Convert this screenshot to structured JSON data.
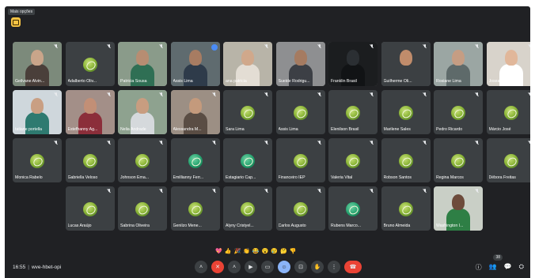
{
  "topbar": {
    "tooltip": "Mais opções"
  },
  "rows": [
    [
      {
        "name": "Geilvane Alvin...",
        "type": "video",
        "bg": "#7c8a7b",
        "skin": "#c9a58a",
        "shirt": "#4a3f3a"
      },
      {
        "name": "Adalberto Oliv...",
        "type": "avatar"
      },
      {
        "name": "Patricia Sousa",
        "type": "video",
        "bg": "#8a9b8a",
        "skin": "#b78d72",
        "shirt": "#2f6f54"
      },
      {
        "name": "Assis Lima",
        "type": "video",
        "bg": "#5f6b6f",
        "skin": "#a77c62",
        "shirt": "#2e3b4a",
        "speaking": true
      },
      {
        "name": "ana patricia",
        "type": "video",
        "bg": "#b8b4a8",
        "skin": "#d0a88b",
        "shirt": "#e3ddd4"
      },
      {
        "name": "Sueide Rodrigu...",
        "type": "video",
        "bg": "#8e8f91",
        "skin": "#a57b61",
        "shirt": "#3c3f45"
      },
      {
        "name": "Franklin Brasil",
        "type": "video",
        "bg": "#1b1d1f",
        "skin": "#2b2f33",
        "shirt": "#111315"
      },
      {
        "name": "Guilherme Oli...",
        "type": "video",
        "bg": "#3c4043",
        "skin": "#c08c6b",
        "shirt": "#3c4043"
      },
      {
        "name": "Rosiane Lima",
        "type": "video",
        "bg": "#9ba6a3",
        "skin": "#c59d83",
        "shirt": "#5e6a6a"
      },
      {
        "name": "Joseane Souza",
        "type": "video",
        "bg": "#d8d3cb",
        "skin": "#e1b79a",
        "shirt": "#ffffff"
      }
    ],
    [
      {
        "name": "tatiane portella",
        "type": "video",
        "bg": "#cfd7dc",
        "skin": "#c99f83",
        "shirt": "#2e7a70"
      },
      {
        "name": "Estefhanny Ag...",
        "type": "video",
        "bg": "#a38f88",
        "skin": "#c28f76",
        "shirt": "#8b2e3a"
      },
      {
        "name": "Nelia Andrade",
        "type": "video",
        "bg": "#8ea28f",
        "skin": "#c89d80",
        "shirt": "#d5d9dc"
      },
      {
        "name": "Alessandra M...",
        "type": "video",
        "bg": "#9c8f84",
        "skin": "#c49a7c",
        "shirt": "#5a4d44"
      },
      {
        "name": "Sara Lima",
        "type": "avatar"
      },
      {
        "name": "Assis Lima",
        "type": "avatar"
      },
      {
        "name": "Elenilson Brasil",
        "type": "avatar"
      },
      {
        "name": "Marilene Sales",
        "type": "avatar"
      },
      {
        "name": "Pedro Ricardo",
        "type": "avatar"
      },
      {
        "name": "Márcio José",
        "type": "avatar"
      }
    ],
    [
      {
        "name": "Monica Rabelo",
        "type": "avatar"
      },
      {
        "name": "Gabriella Veloso",
        "type": "avatar"
      },
      {
        "name": "Johnson Ema...",
        "type": "avatar"
      },
      {
        "name": "Emillianny Ferr...",
        "type": "avatar-teal"
      },
      {
        "name": "Estagiario Cap...",
        "type": "avatar-teal"
      },
      {
        "name": "Financeiro IEP",
        "type": "avatar"
      },
      {
        "name": "Valeria Vital",
        "type": "avatar"
      },
      {
        "name": "Robson Santos",
        "type": "avatar"
      },
      {
        "name": "Regina Marcos",
        "type": "avatar"
      },
      {
        "name": "Débora Freitas",
        "type": "avatar"
      }
    ],
    [
      {
        "name": "Lucas Araújo",
        "type": "avatar"
      },
      {
        "name": "Sabrina Oliveira",
        "type": "avatar"
      },
      {
        "name": "Genilzo Mene...",
        "type": "avatar"
      },
      {
        "name": "Alyny Cristyel...",
        "type": "avatar"
      },
      {
        "name": "Carlos Augusto",
        "type": "avatar"
      },
      {
        "name": "Rubens Marco...",
        "type": "avatar-teal"
      },
      {
        "name": "Bruno Almeida",
        "type": "avatar"
      },
      {
        "name": "Washington I...",
        "type": "video",
        "bg": "#c9cfc6",
        "skin": "#6d4b3b",
        "shirt": "#2e7f45"
      }
    ]
  ],
  "reactions": [
    "💖",
    "👍",
    "🎉",
    "👏",
    "😂",
    "😮",
    "😢",
    "🤔",
    "👎"
  ],
  "meeting": {
    "time": "16:55",
    "separator": "|",
    "code": "wve-hbet-opi"
  },
  "controls": [
    {
      "id": "caret",
      "label": "˄",
      "style": ""
    },
    {
      "id": "mic",
      "label": "✕",
      "style": "red"
    },
    {
      "id": "caret2",
      "label": "˄",
      "style": ""
    },
    {
      "id": "camera",
      "label": "▶",
      "style": ""
    },
    {
      "id": "captions",
      "label": "▭",
      "style": ""
    },
    {
      "id": "reactions",
      "label": "☺",
      "style": "blue"
    },
    {
      "id": "present",
      "label": "⊡",
      "style": ""
    },
    {
      "id": "raise-hand",
      "label": "✋",
      "style": ""
    },
    {
      "id": "more",
      "label": "⋮",
      "style": ""
    },
    {
      "id": "end-call",
      "label": "☎",
      "style": "end"
    }
  ],
  "right": {
    "participants_count": "38",
    "info_icon": "ⓘ",
    "people_icon": "👥",
    "chat_icon": "💬",
    "activities_icon": "⛭"
  }
}
